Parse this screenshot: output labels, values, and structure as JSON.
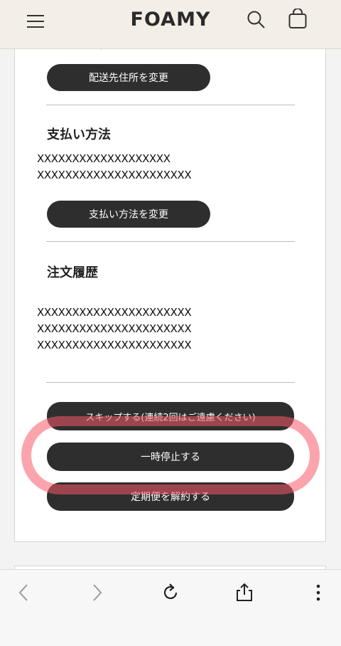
{
  "header": {
    "logo": "FOAMY",
    "icons": [
      "menu-icon",
      "search-icon",
      "cart-icon"
    ]
  },
  "shipping": {
    "clipped_text": "…  …  … ・ 。",
    "change_button": "配送先住所を変更"
  },
  "payment": {
    "title": "支払い方法",
    "lines": [
      "XXXXXXXXXXXXXXXXXXX",
      "XXXXXXXXXXXXXXXXXXXXXX"
    ],
    "change_button": "支払い方法を変更"
  },
  "history": {
    "title": "注文履歴",
    "lines": [
      "XXXXXXXXXXXXXXXXXXXXXX",
      "XXXXXXXXXXXXXXXXXXXXXX",
      "XXXXXXXXXXXXXXXXXXXXXX"
    ]
  },
  "actions": {
    "skip_button": "スキップする(連続2回はご遠慮ください)",
    "pause_button": "一時停止する",
    "cancel_button": "定期便を解約する"
  },
  "colors": {
    "button_bg": "#2e2e2e",
    "header_bg": "#f3efe7",
    "highlight": "#fa5a69"
  },
  "browser": {
    "icons": [
      "back-icon",
      "forward-icon",
      "reload-icon",
      "share-icon",
      "more-icon"
    ]
  }
}
